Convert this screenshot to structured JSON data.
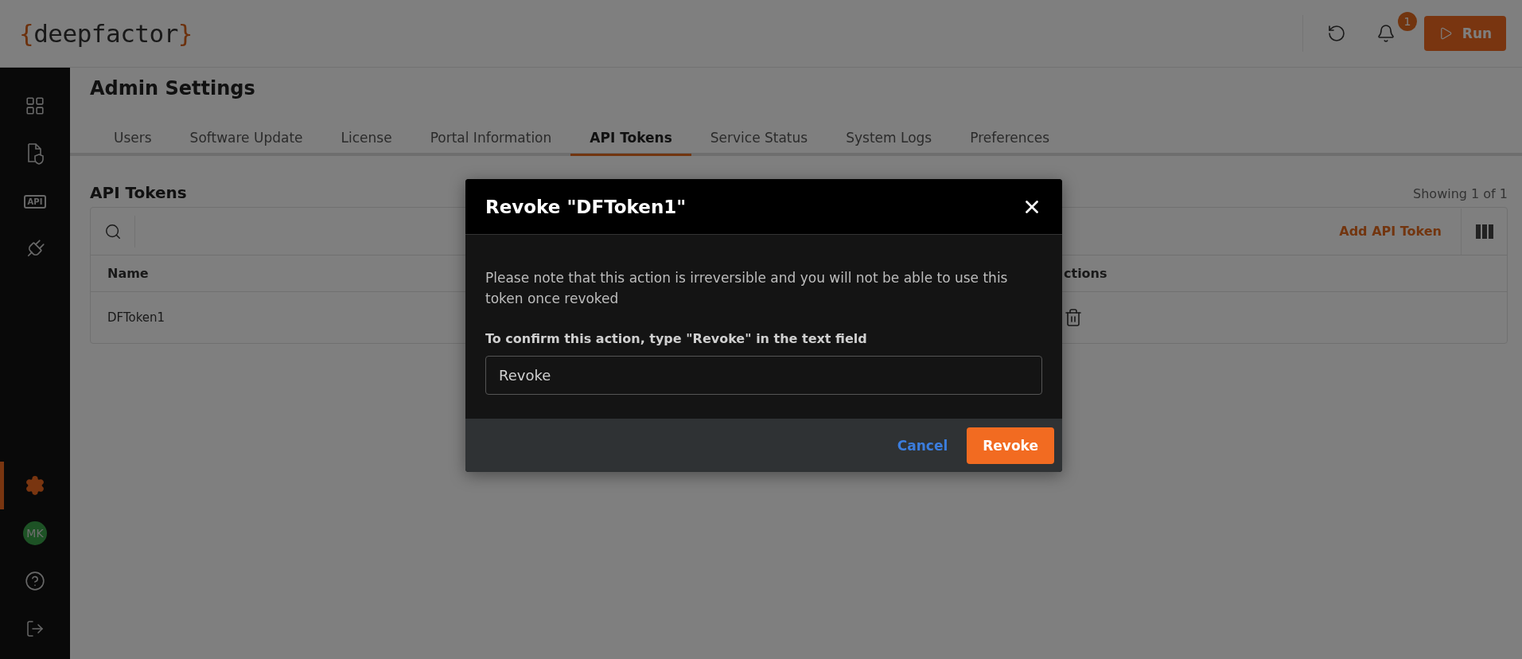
{
  "header": {
    "logo": {
      "open": "{",
      "word": "deepfactor",
      "close": "}"
    },
    "notifications": "1",
    "run_button": "Run"
  },
  "sidebar": {
    "top": [
      {
        "kind": "dashboard",
        "selected": false
      },
      {
        "kind": "document",
        "selected": false
      },
      {
        "kind": "api",
        "text": "API",
        "selected": false
      },
      {
        "kind": "plug",
        "selected": false
      }
    ],
    "bottom": [
      {
        "kind": "settings",
        "selected": true
      },
      {
        "kind": "avatar",
        "text": "MK",
        "selected": false
      },
      {
        "kind": "help",
        "selected": false
      },
      {
        "kind": "logout",
        "selected": false
      }
    ]
  },
  "page": {
    "title": "Admin Settings",
    "tabs": [
      {
        "label": "Users",
        "selected": false
      },
      {
        "label": "Software Update",
        "selected": false
      },
      {
        "label": "License",
        "selected": false
      },
      {
        "label": "Portal Information",
        "selected": false
      },
      {
        "label": "API Tokens",
        "selected": true
      },
      {
        "label": "Service Status",
        "selected": false
      },
      {
        "label": "System Logs",
        "selected": false
      },
      {
        "label": "Preferences",
        "selected": false
      }
    ],
    "section_title": "API Tokens",
    "showing": "Showing 1 of 1",
    "add_button": "Add API Token",
    "table": {
      "columns": [
        "Name",
        "ctions"
      ],
      "rows": [
        {
          "name": "DFToken1"
        }
      ]
    }
  },
  "dialog": {
    "title": "Revoke \"DFToken1\"",
    "message": "Please note that this action is irreversible and you will not be able to use this token once revoked",
    "label": "To confirm this action, type \"Revoke\" in the text field",
    "value": "Revoke",
    "cancel": "Cancel",
    "confirm": "Revoke"
  }
}
